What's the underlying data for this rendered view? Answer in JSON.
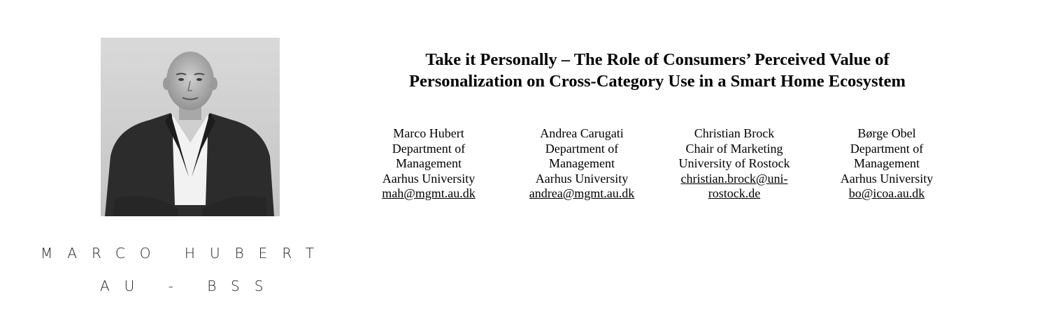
{
  "profile": {
    "name": "MARCO HUBERT",
    "affiliation": "AU - BSS"
  },
  "paper": {
    "title_line1": "Take it Personally – The Role of Consumers’ Perceived Value of",
    "title_line2": "Personalization on Cross-Category Use in a Smart Home Ecosystem"
  },
  "authors": [
    {
      "name": "Marco Hubert",
      "dept_line1": "Department of",
      "dept_line2": "Management",
      "university": "Aarhus University",
      "email": "mah@mgmt.au.dk"
    },
    {
      "name": "Andrea Carugati",
      "dept_line1": "Department of",
      "dept_line2": "Management",
      "university": "Aarhus University",
      "email": "andrea@mgmt.au.dk"
    },
    {
      "name": "Christian Brock",
      "dept_line1": "Chair of Marketing",
      "university": "University of Rostock",
      "email_line1": "christian.brock@uni-",
      "email_line2": "rostock.de"
    },
    {
      "name": "Børge Obel",
      "dept_line1": "Department of",
      "dept_line2": "Management",
      "university": "Aarhus University",
      "email": "bo@icoa.au.dk"
    }
  ]
}
